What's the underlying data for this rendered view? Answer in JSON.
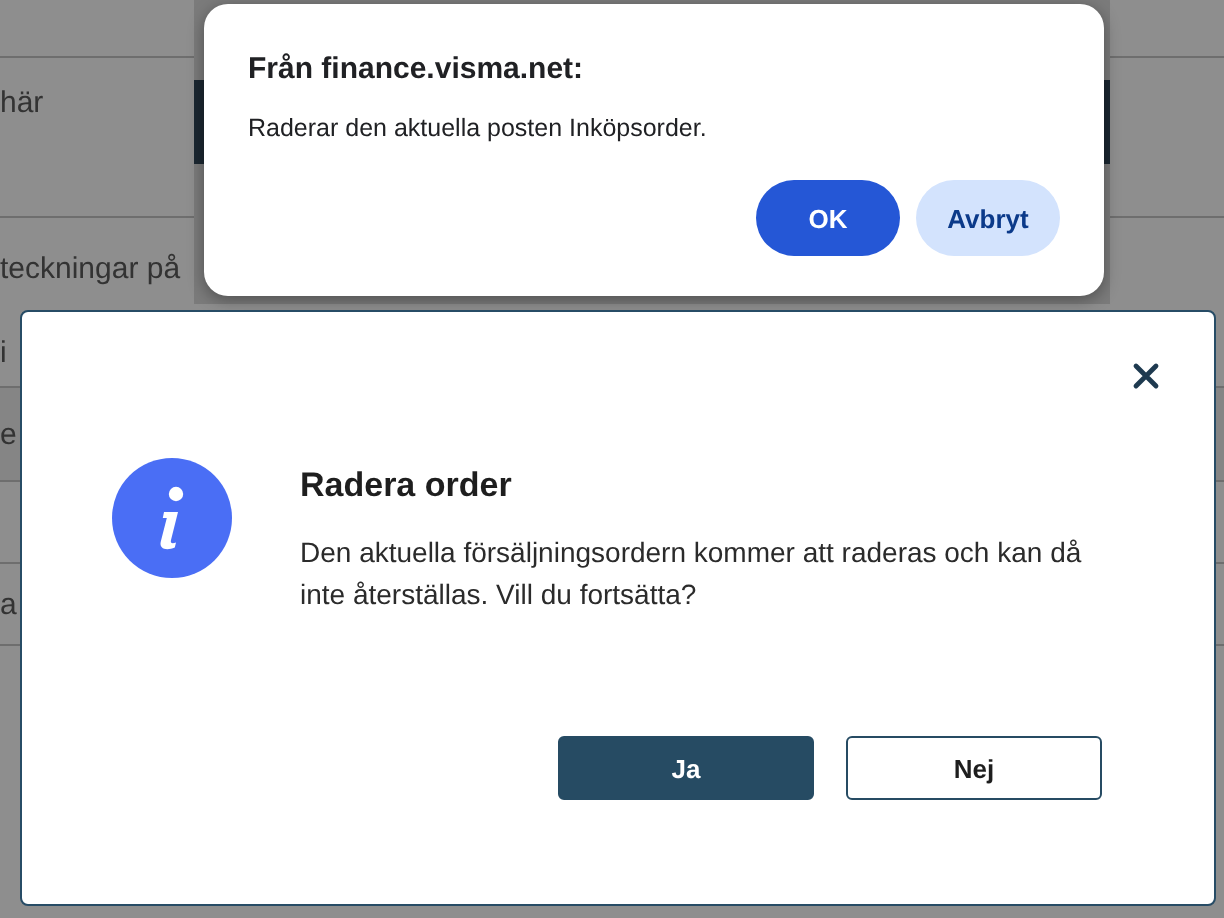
{
  "page_behind": {
    "rows": [
      {
        "text": "här"
      },
      {
        "text": "teckningar på"
      },
      {
        "text": "i"
      },
      {
        "text": "e"
      },
      {
        "text": "a"
      }
    ]
  },
  "browser_dialog": {
    "title": "Från finance.visma.net:",
    "message": "Raderar den aktuella posten Inköpsorder.",
    "buttons": [
      {
        "label": "OK",
        "kind": "primary"
      },
      {
        "label": "Avbryt",
        "kind": "secondary"
      }
    ]
  },
  "modal": {
    "title": "Radera order",
    "message": "Den aktuella försäljningsordern kommer att raderas och kan då inte återställas. Vill du fortsätta?",
    "buttons": [
      {
        "label": "Ja",
        "kind": "primary"
      },
      {
        "label": "Nej",
        "kind": "secondary"
      }
    ]
  }
}
